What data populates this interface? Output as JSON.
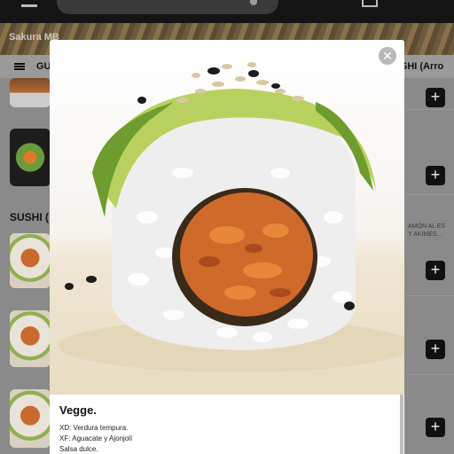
{
  "banner": {
    "shop_name": "Sakura MB"
  },
  "category_bar": {
    "tab_left": "GU",
    "tab_right": "SHI (Arro"
  },
  "list": {
    "section_title": "SUSHI (",
    "side_description_1": "AMÓN AL ES",
    "side_description_2": "Y AKIMES...",
    "plus_label": "+"
  },
  "modal": {
    "close_label": "✕",
    "title": "Vegge.",
    "lines": [
      "XD: Verdura tempura.",
      "XF: Aguacate y Ajonjolí",
      "Salsa dulce."
    ]
  },
  "icons": {
    "menu": "hamburger-icon",
    "close": "close-icon",
    "add": "plus-icon"
  },
  "colors": {
    "topbar": "#141414",
    "overlay": "#8a8a8a",
    "button": "#111111"
  }
}
